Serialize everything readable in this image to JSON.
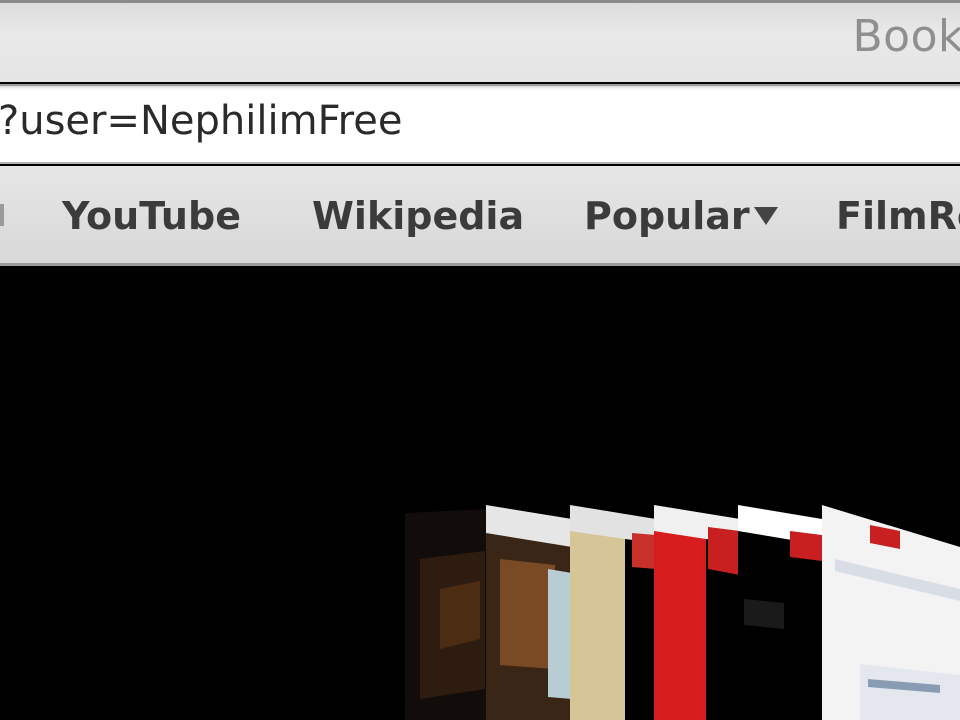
{
  "window": {
    "bookmarks_label": "Book"
  },
  "address_bar": {
    "url_fragment": "?user=NephilimFree"
  },
  "bookmarks_bar": {
    "items": [
      {
        "label": "YouTube"
      },
      {
        "label": "Wikipedia"
      },
      {
        "label": "Popular",
        "has_menu": true
      },
      {
        "label": "FilmRe"
      }
    ]
  },
  "content": {
    "view": "cover-flow",
    "thumbnails": [
      {
        "name": "page-thumb-1",
        "colors": [
          "#1a1410",
          "#3a2414"
        ]
      },
      {
        "name": "page-thumb-2",
        "colors": [
          "#d8c8a0",
          "#5a3a20",
          "#e6e6e6"
        ]
      },
      {
        "name": "page-thumb-3",
        "colors": [
          "#d9c79a",
          "#000000",
          "#c8302a"
        ]
      },
      {
        "name": "page-thumb-4",
        "colors": [
          "#d81f1f",
          "#000000",
          "#ffffff"
        ]
      },
      {
        "name": "page-thumb-5",
        "colors": [
          "#000000",
          "#ffffff",
          "#c82020"
        ]
      },
      {
        "name": "page-thumb-6",
        "colors": [
          "#f2f2f2",
          "#c82020",
          "#d8dde6"
        ]
      }
    ]
  },
  "colors": {
    "chrome_gray": "#e4e4e4",
    "bookmark_text": "#3b3b3b",
    "url_text": "#2a2a2a",
    "background": "#000000"
  }
}
